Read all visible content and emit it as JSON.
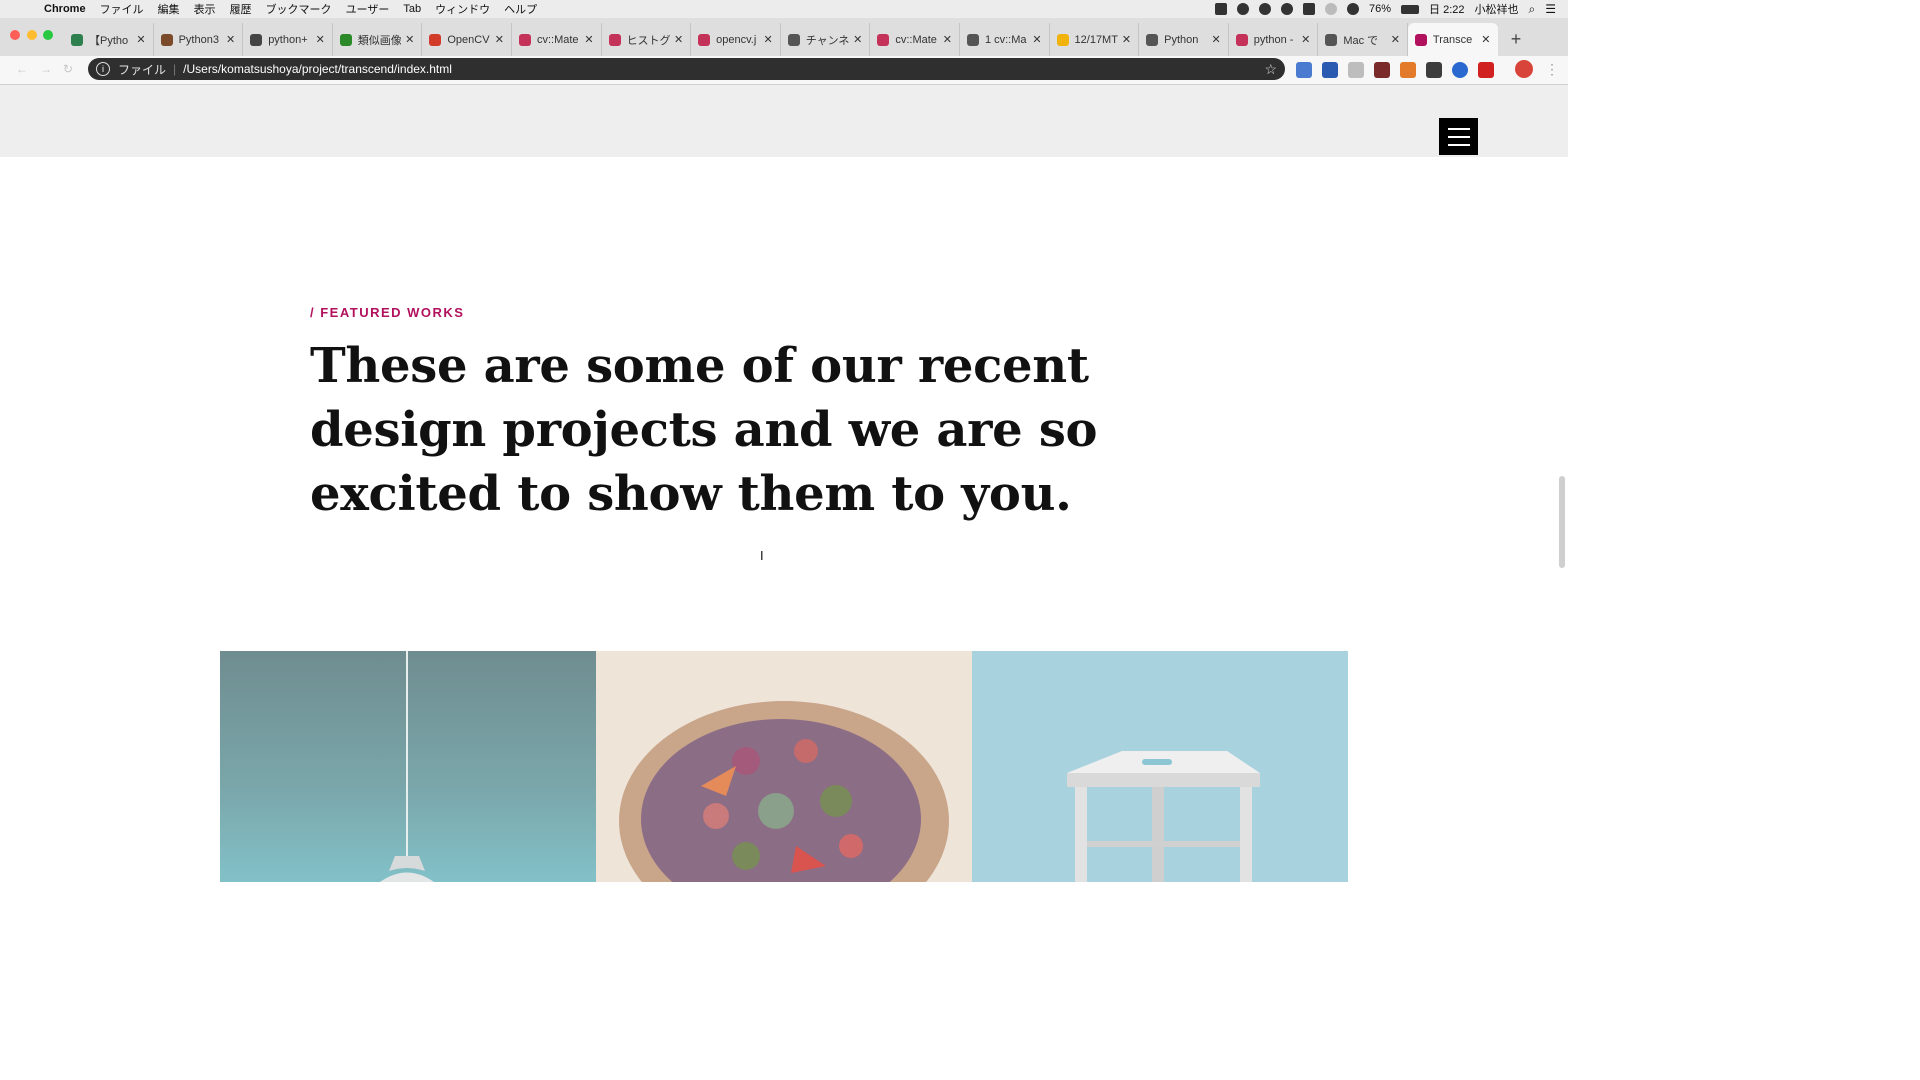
{
  "menubar": {
    "app": "Chrome",
    "items": [
      "ファイル",
      "編集",
      "表示",
      "履歴",
      "ブックマーク",
      "ユーザー",
      "Tab",
      "ウィンドウ",
      "ヘルプ"
    ],
    "battery": "76%",
    "clock": "日 2:22",
    "user": "小松祥也"
  },
  "tabs": [
    {
      "label": "【Pytho",
      "color": "#2d7f4e"
    },
    {
      "label": "Python3",
      "color": "#7a4a2a"
    },
    {
      "label": "python+",
      "color": "#444444"
    },
    {
      "label": "類似画像",
      "color": "#2a8a2a"
    },
    {
      "label": "OpenCV",
      "color": "#d23a2a"
    },
    {
      "label": "cv::Mate",
      "color": "#c4325a"
    },
    {
      "label": "ヒストグ",
      "color": "#c4325a"
    },
    {
      "label": "opencv.j",
      "color": "#c4325a"
    },
    {
      "label": "チャンネ",
      "color": "#555555"
    },
    {
      "label": "cv::Mate",
      "color": "#c4325a"
    },
    {
      "label": "1 cv::Ma",
      "color": "#555555"
    },
    {
      "label": "12/17MT",
      "color": "#f2b20c"
    },
    {
      "label": "Python",
      "color": "#555555"
    },
    {
      "label": "python -",
      "color": "#c4325a"
    },
    {
      "label": "Mac で",
      "color": "#555555"
    },
    {
      "label": "Transce",
      "color": "#b2115e"
    }
  ],
  "address": {
    "scheme": "ファイル",
    "url": "/Users/komatsushoya/project/transcend/index.html"
  },
  "page": {
    "eyebrow": "/ FEATURED WORKS",
    "headline": "These are some of our recent design projects and we are so excited to show them to you.",
    "works": [
      "lamp-photo",
      "salad-bowl-photo",
      "stool-photo"
    ],
    "accent": "#b2115e"
  }
}
